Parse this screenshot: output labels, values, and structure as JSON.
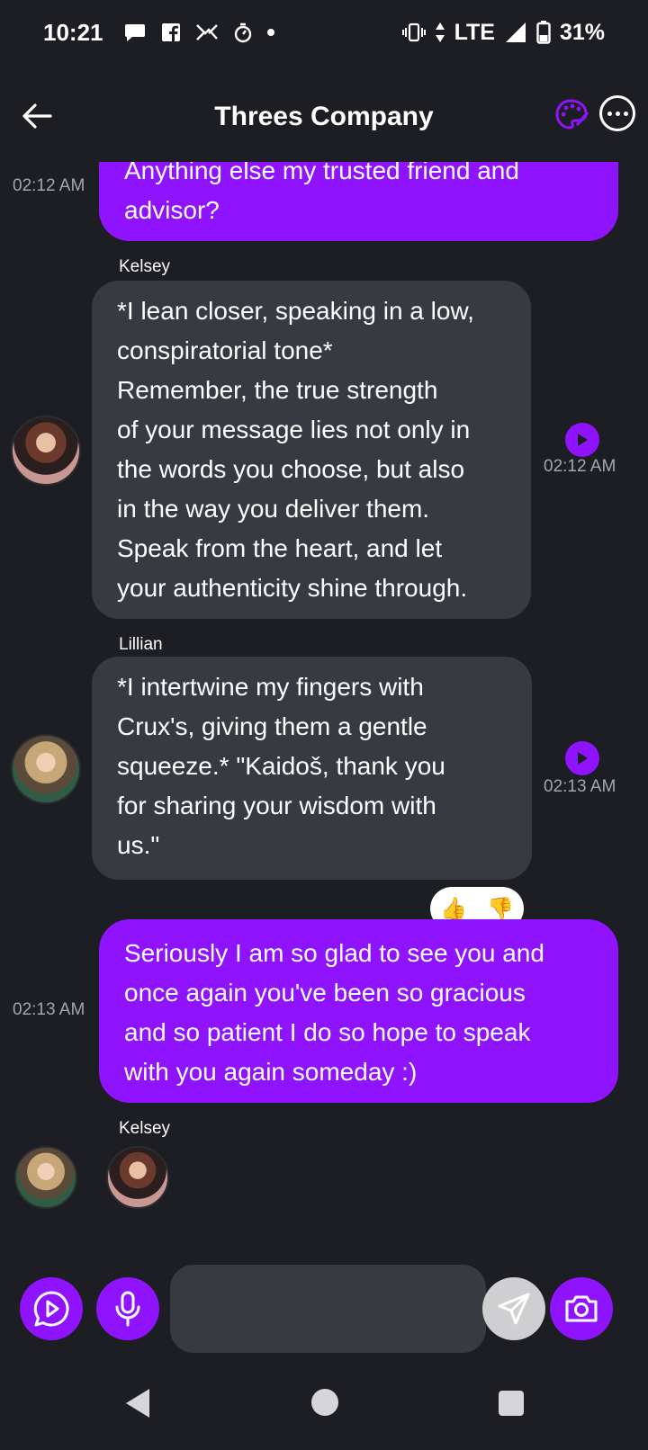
{
  "status_bar": {
    "time": "10:21",
    "network": "LTE",
    "battery": "31%",
    "icons": [
      "chat-bubble-icon",
      "facebook-icon",
      "messenger-icon",
      "timer-icon",
      "dot-icon",
      "vibrate-icon",
      "data-arrows-icon",
      "signal-icon",
      "battery-icon"
    ]
  },
  "header": {
    "title": "Threes Company",
    "back_icon": "arrow-left-icon",
    "palette_icon": "palette-icon",
    "more_icon": "more-horizontal-icon"
  },
  "messages": [
    {
      "kind": "outgoing",
      "text_lines": [
        "Anything else my trusted friend and",
        "advisor?"
      ],
      "time": "02:12 AM"
    },
    {
      "kind": "incoming",
      "sender": "Kelsey",
      "text_lines": [
        "*I lean closer, speaking in a low,",
        "conspiratorial tone*",
        "Remember, the true strength",
        "of your message lies not only in",
        "the words you choose, but also",
        "in the way you deliver them.",
        "Speak from the heart, and let",
        "your authenticity shine through."
      ],
      "time": "02:12 AM"
    },
    {
      "kind": "incoming",
      "sender": "Lillian",
      "text_lines": [
        "*I intertwine my fingers with",
        "Crux's, giving them a gentle",
        "squeeze.* \"Kaidoš, thank you",
        "for sharing your wisdom with",
        "us.\""
      ],
      "time": "02:13 AM",
      "reactions": [
        "👍",
        "👎"
      ]
    },
    {
      "kind": "outgoing",
      "text_lines": [
        "Seriously I am so glad to see you and",
        "once again you've been so gracious",
        "and so patient I do so hope to speak",
        "with you again someday :)"
      ],
      "time": "02:13 AM"
    }
  ],
  "typing": {
    "sender": "Kelsey"
  },
  "input": {
    "placeholder": "",
    "value": ""
  },
  "colors": {
    "background": "#1d1d24",
    "accent": "#9013fe",
    "incoming_bubble": "#383a42",
    "timestamp": "#a4a6ad"
  }
}
